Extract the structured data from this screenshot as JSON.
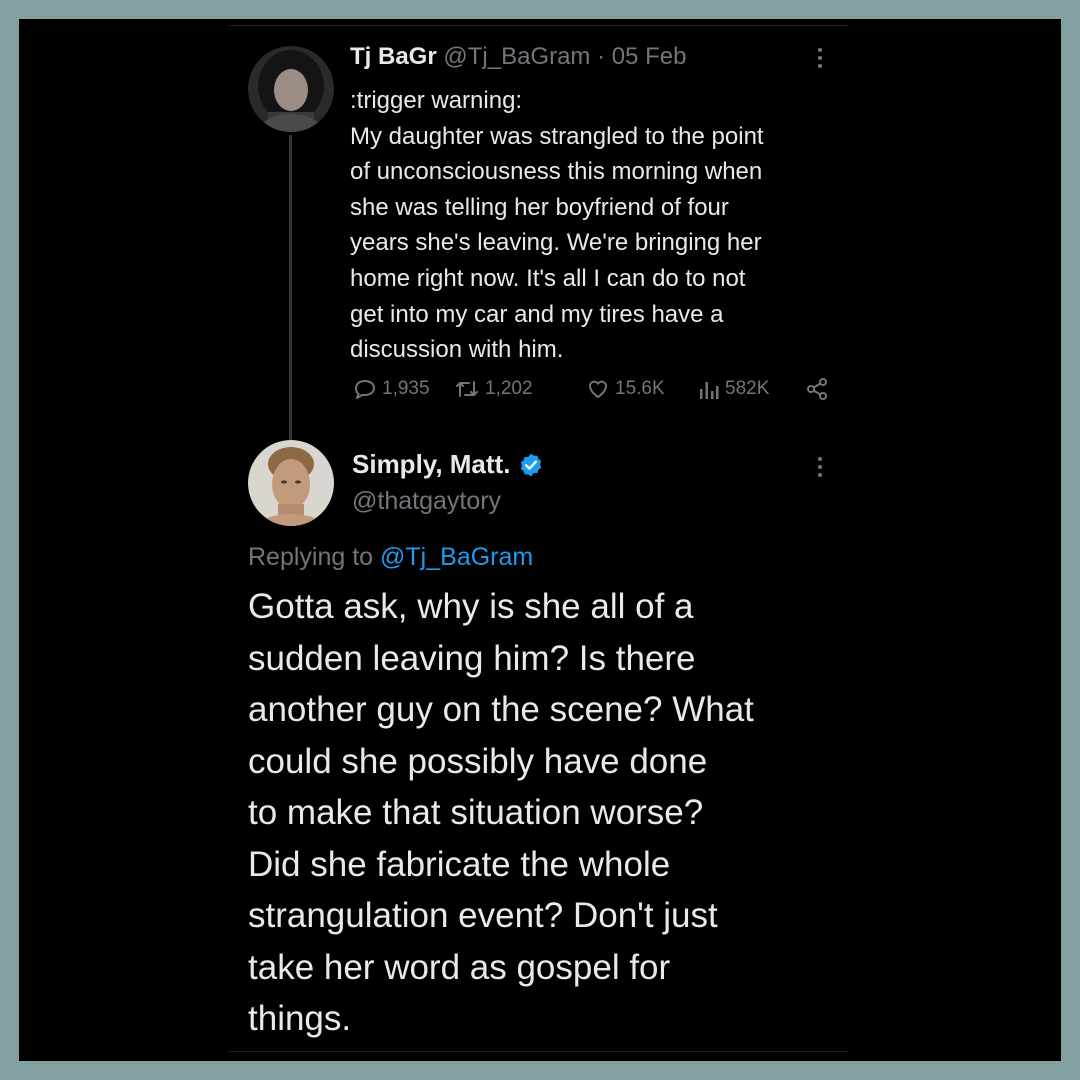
{
  "original_tweet": {
    "author_name": "Tj BaGr",
    "author_handle": "@Tj_BaGram",
    "separator": " · ",
    "date": "05 Feb",
    "text": ":trigger warning:\nMy daughter was strangled to the point\nof unconsciousness this morning when\nshe was telling her boyfriend of four\nyears she's leaving. We're bringing her\nhome right now. It's all I can do to not\nget into my car and my tires have a\ndiscussion with him.",
    "stats": {
      "replies": "1,935",
      "retweets": "1,202",
      "likes": "15.6K",
      "views": "582K"
    }
  },
  "reply_tweet": {
    "author_name": "Simply, Matt.",
    "verified": true,
    "author_handle": "@thatgaytory",
    "replying_prefix": "Replying to ",
    "replying_to": "@Tj_BaGram",
    "text": "Gotta ask, why is she all of a\nsudden leaving him? Is there\nanother guy on the scene? What\ncould she possibly have done\nto make that situation worse?\nDid she fabricate the whole\nstrangulation event? Don't just\ntake her word as gospel for\nthings."
  },
  "colors": {
    "background": "#000000",
    "frame_border": "#84a1a2",
    "text_primary": "#e7e9ea",
    "text_secondary": "#71767b",
    "link": "#1d9bf0",
    "verified_badge": "#1d9bf0"
  },
  "icons": [
    "reply-icon",
    "retweet-icon",
    "like-icon",
    "views-icon",
    "share-icon",
    "verified-badge-icon",
    "more-options-icon"
  ]
}
